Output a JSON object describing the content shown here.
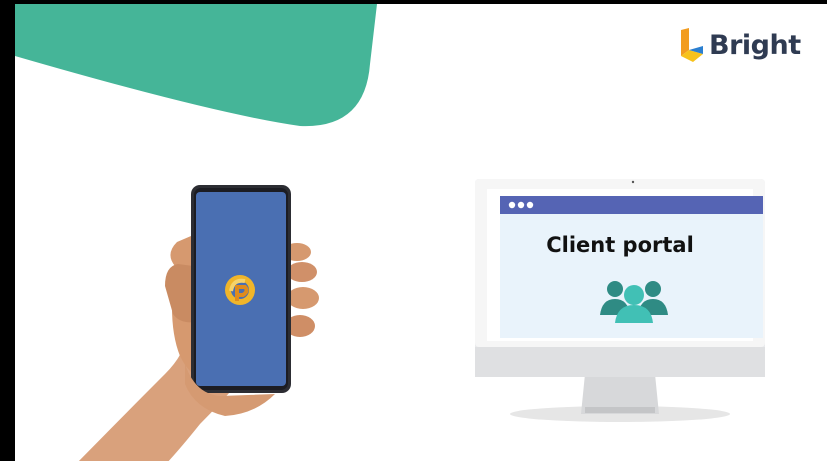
{
  "brand": {
    "name": "Bright",
    "colors": {
      "accent": "#45b598",
      "logo_orange": "#f29c1f",
      "logo_blue": "#2b7fd0",
      "logo_yellow": "#f7c21c"
    }
  },
  "phone": {
    "app_icon": "bright-app-icon",
    "screen_color": "#4a6fb2"
  },
  "portal": {
    "title": "Client portal",
    "header_color": "#5564b4",
    "icon": "people-group-icon"
  }
}
